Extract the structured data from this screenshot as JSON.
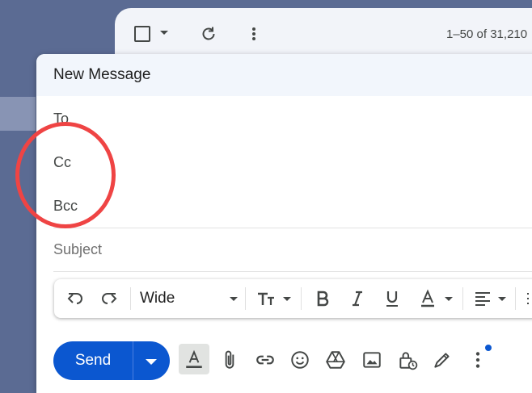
{
  "inbox": {
    "range_label": "1–50 of 31,210"
  },
  "compose": {
    "title": "New Message",
    "fields": {
      "to": "To",
      "cc": "Cc",
      "bcc": "Bcc",
      "subject_placeholder": "Subject"
    },
    "format_toolbar": {
      "font_name": "Wide",
      "icons": [
        "undo-icon",
        "redo-icon",
        "text-size-icon",
        "bold-icon",
        "italic-icon",
        "underline-icon",
        "text-color-icon",
        "align-icon"
      ]
    },
    "actions": {
      "send_label": "Send",
      "icons": [
        "formatting-options-icon",
        "attach-icon",
        "link-icon",
        "emoji-icon",
        "drive-icon",
        "photo-icon",
        "confidential-mode-icon",
        "signature-icon",
        "more-options-icon"
      ]
    }
  },
  "colors": {
    "send_blue": "#0b57d0",
    "highlight_red": "#ef4444",
    "page_bg": "#5b6b93"
  }
}
